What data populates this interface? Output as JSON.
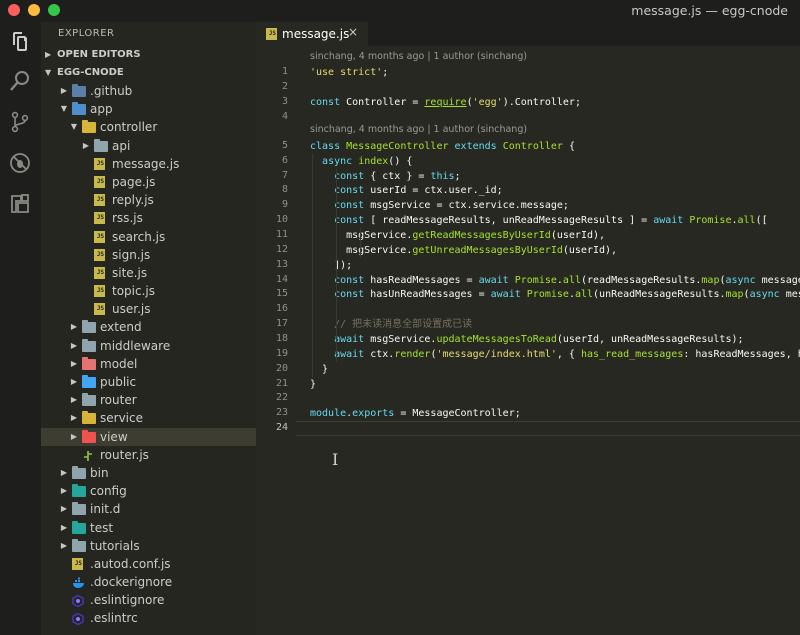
{
  "window": {
    "title": "message.js — egg-cnode"
  },
  "activity_icons": [
    {
      "name": "explorer-icon",
      "color": "#cccccc"
    },
    {
      "name": "search-icon",
      "color": "#8a8a85"
    },
    {
      "name": "source-control-icon",
      "color": "#8a8a85"
    },
    {
      "name": "debug-icon",
      "color": "#8a8a85"
    },
    {
      "name": "extensions-icon",
      "color": "#8a8a85"
    }
  ],
  "sidebar": {
    "title": "EXPLORER",
    "open_editors": "OPEN EDITORS",
    "project": "EGG-CNODE",
    "tree": [
      {
        "label": ".github",
        "depth": 1,
        "kind": "folder",
        "expanded": false,
        "color": "#5a7fa8"
      },
      {
        "label": "app",
        "depth": 1,
        "kind": "folder",
        "expanded": true,
        "color": "#4e8fc9"
      },
      {
        "label": "controller",
        "depth": 2,
        "kind": "folder",
        "expanded": true,
        "color": "#d8b43a"
      },
      {
        "label": "api",
        "depth": 3,
        "kind": "folder",
        "expanded": false,
        "color": "#90a4ae"
      },
      {
        "label": "message.js",
        "depth": 3,
        "kind": "js"
      },
      {
        "label": "page.js",
        "depth": 3,
        "kind": "js"
      },
      {
        "label": "reply.js",
        "depth": 3,
        "kind": "js"
      },
      {
        "label": "rss.js",
        "depth": 3,
        "kind": "js"
      },
      {
        "label": "search.js",
        "depth": 3,
        "kind": "js"
      },
      {
        "label": "sign.js",
        "depth": 3,
        "kind": "js"
      },
      {
        "label": "site.js",
        "depth": 3,
        "kind": "js"
      },
      {
        "label": "topic.js",
        "depth": 3,
        "kind": "js"
      },
      {
        "label": "user.js",
        "depth": 3,
        "kind": "js"
      },
      {
        "label": "extend",
        "depth": 2,
        "kind": "folder",
        "expanded": false,
        "color": "#90a4ae"
      },
      {
        "label": "middleware",
        "depth": 2,
        "kind": "folder",
        "expanded": false,
        "color": "#90a4ae"
      },
      {
        "label": "model",
        "depth": 2,
        "kind": "folder",
        "expanded": false,
        "color": "#e57373"
      },
      {
        "label": "public",
        "depth": 2,
        "kind": "folder",
        "expanded": false,
        "color": "#42a5f5"
      },
      {
        "label": "router",
        "depth": 2,
        "kind": "folder",
        "expanded": false,
        "color": "#90a4ae"
      },
      {
        "label": "service",
        "depth": 2,
        "kind": "folder",
        "expanded": false,
        "color": "#d8b43a"
      },
      {
        "label": "view",
        "depth": 2,
        "kind": "folder",
        "expanded": false,
        "color": "#ef5350",
        "selected": true
      },
      {
        "label": "router.js",
        "depth": 2,
        "kind": "router"
      },
      {
        "label": "bin",
        "depth": 1,
        "kind": "folder",
        "expanded": false,
        "color": "#90a4ae"
      },
      {
        "label": "config",
        "depth": 1,
        "kind": "folder",
        "expanded": false,
        "color": "#26a69a"
      },
      {
        "label": "init.d",
        "depth": 1,
        "kind": "folder",
        "expanded": false,
        "color": "#90a4ae"
      },
      {
        "label": "test",
        "depth": 1,
        "kind": "folder",
        "expanded": false,
        "color": "#26a69a"
      },
      {
        "label": "tutorials",
        "depth": 1,
        "kind": "folder",
        "expanded": false,
        "color": "#90a4ae"
      },
      {
        "label": ".autod.conf.js",
        "depth": 1,
        "kind": "js"
      },
      {
        "label": ".dockerignore",
        "depth": 1,
        "kind": "docker"
      },
      {
        "label": ".eslintignore",
        "depth": 1,
        "kind": "eslint"
      },
      {
        "label": ".eslintrc",
        "depth": 1,
        "kind": "eslint"
      }
    ]
  },
  "tab": {
    "label": "message.js",
    "close": "×"
  },
  "code_lens": {
    "line1": "sinchang, 4 months ago | 1 author (sinchang)",
    "line5": "sinchang, 4 months ago | 1 author (sinchang)"
  },
  "code": {
    "active_line": 24,
    "lines": [
      {
        "n": 1,
        "html": "<span class=\"s\">'use strict'</span>;"
      },
      {
        "n": 2,
        "html": ""
      },
      {
        "n": 3,
        "html": "<span class=\"k\">const</span> Controller = <span class=\"f cu\">require</span>(<span class=\"s\">'egg'</span>).Controller;"
      },
      {
        "n": 4,
        "html": ""
      },
      {
        "n": 5,
        "html": "<span class=\"k\">class</span> <span class=\"f\">MessageController</span> <span class=\"k\">extends</span> <span class=\"f\">Controller</span> {"
      },
      {
        "n": 6,
        "html": "  <span class=\"k\">async</span> <span class=\"f\">index</span>() {"
      },
      {
        "n": 7,
        "html": "    <span class=\"k\">const</span> { ctx } = <span class=\"k\">this</span>;"
      },
      {
        "n": 8,
        "html": "    <span class=\"k\">const</span> userId = ctx.user._id;"
      },
      {
        "n": 9,
        "html": "    <span class=\"k\">const</span> msgService = ctx.service.message;"
      },
      {
        "n": 10,
        "html": "    <span class=\"k\">const</span> [ readMessageResults, unReadMessageResults ] = <span class=\"k\">await</span> <span class=\"f\">Promise</span>.<span class=\"f\">all</span>(["
      },
      {
        "n": 11,
        "html": "      msgService.<span class=\"f\">getReadMessagesByUserId</span>(userId),"
      },
      {
        "n": 12,
        "html": "      msgService.<span class=\"f\">getUnreadMessagesByUserId</span>(userId),"
      },
      {
        "n": 13,
        "html": "    ]);"
      },
      {
        "n": 14,
        "html": "    <span class=\"k\">const</span> hasReadMessages = <span class=\"k\">await</span> <span class=\"f\">Promise</span>.<span class=\"f\">all</span>(readMessageResults.<span class=\"f\">map</span>(<span class=\"k\">async</span> message"
      },
      {
        "n": 15,
        "html": "    <span class=\"k\">const</span> hasUnReadMessages = <span class=\"k\">await</span> <span class=\"f\">Promise</span>.<span class=\"f\">all</span>(unReadMessageResults.<span class=\"f\">map</span>(<span class=\"k\">async</span> mes"
      },
      {
        "n": 16,
        "html": ""
      },
      {
        "n": 17,
        "html": "    <span class=\"c\">// 把未读消息全部设置成已读</span>"
      },
      {
        "n": 18,
        "html": "    <span class=\"k\">await</span> msgService.<span class=\"f\">updateMessagesToRead</span>(userId, unReadMessageResults);"
      },
      {
        "n": 19,
        "html": "    <span class=\"k\">await</span> ctx.<span class=\"f\">render</span>(<span class=\"s\">'message/index.html'</span>, { <span class=\"f\">has_read_messages</span>: hasReadMessages, h"
      },
      {
        "n": 20,
        "html": "  }"
      },
      {
        "n": 21,
        "html": "}"
      },
      {
        "n": 22,
        "html": ""
      },
      {
        "n": 23,
        "html": "<span class=\"k\">module</span>.<span class=\"k\">exports</span> = MessageController;"
      },
      {
        "n": 24,
        "html": ""
      }
    ]
  }
}
